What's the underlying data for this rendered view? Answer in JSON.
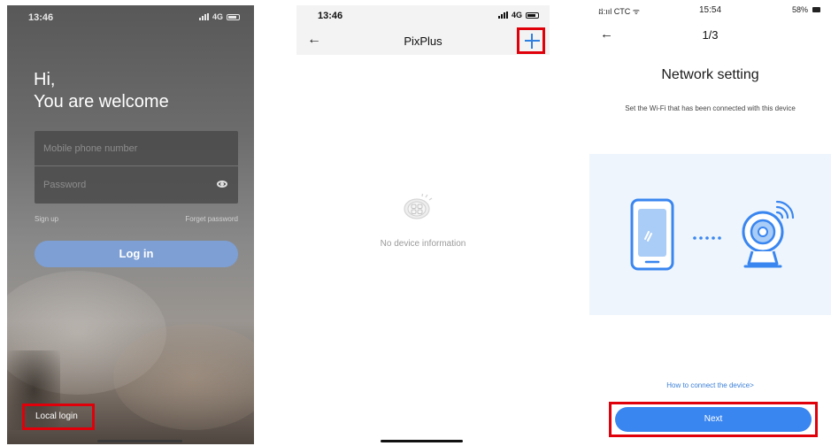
{
  "login_screen": {
    "status": {
      "time": "13:46",
      "network": "4G"
    },
    "greeting_line1": "Hi,",
    "greeting_line2": "You are welcome",
    "phone_placeholder": "Mobile phone number",
    "password_placeholder": "Password",
    "sign_up": "Sign up",
    "forget_password": "Forget password",
    "login_button": "Log in",
    "local_login": "Local login"
  },
  "device_screen": {
    "status": {
      "time": "13:46",
      "network": "4G"
    },
    "title": "PixPlus",
    "empty_text": "No device information",
    "icons": {
      "back": "back-arrow-icon",
      "add": "plus-icon",
      "empty": "device-placeholder-icon"
    }
  },
  "network_screen": {
    "status": {
      "carrier": "ដ:ııl CTC ᯤ",
      "time": "15:54",
      "battery": "58%"
    },
    "step": "1/3",
    "heading": "Network setting",
    "subtitle": "Set the Wi-Fi that has been connected with this device",
    "how_to_link": "How to connect the device>",
    "next_button": "Next",
    "colors": {
      "accent": "#3a86f0",
      "illustration_bg": "#eef5fd",
      "highlight": "#e0000a"
    }
  }
}
